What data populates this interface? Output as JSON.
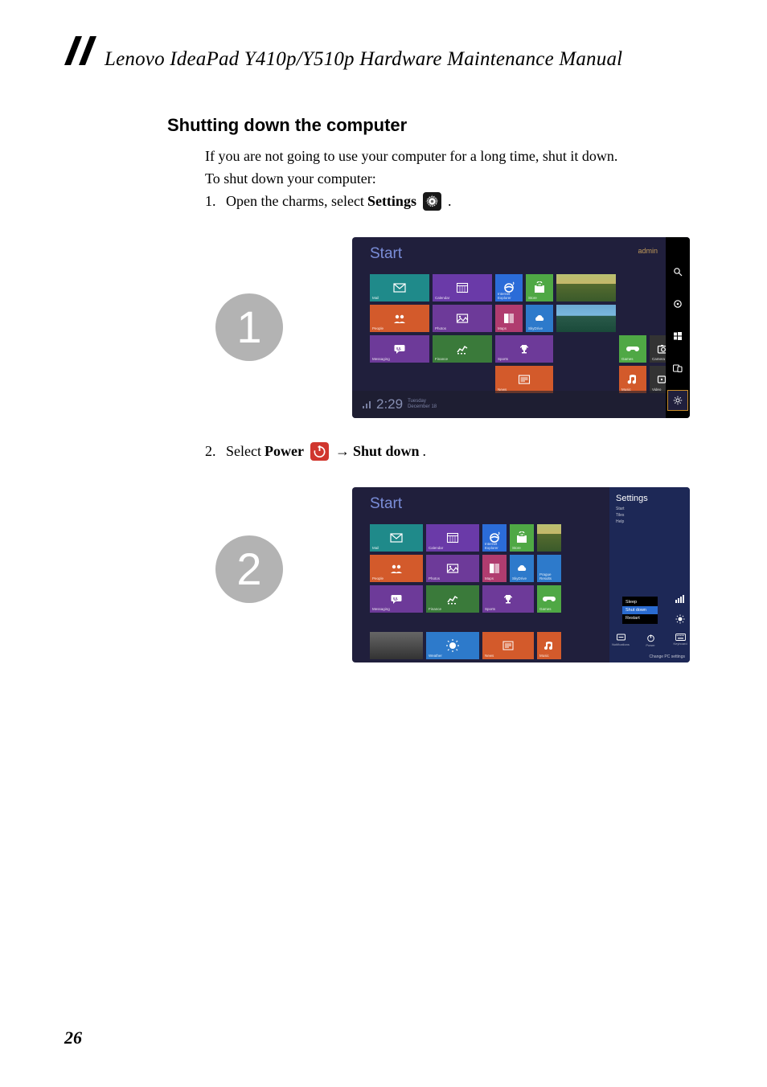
{
  "header": {
    "doc_title": "Lenovo IdeaPad Y410p/Y510p Hardware Maintenance Manual"
  },
  "section": {
    "heading": "Shutting down the computer",
    "intro1": "If you are not going to use your computer for a long time, shut it down.",
    "intro2": "To shut down your computer:"
  },
  "steps": {
    "s1_num": "1.",
    "s1_pre": "Open the charms, select ",
    "s1_bold": "Settings",
    "s1_post": " .",
    "s2_num": "2.",
    "s2_pre": "Select ",
    "s2_bold1": "Power",
    "s2_arrow": " →",
    "s2_bold2": " Shut down",
    "s2_post": "."
  },
  "figures": {
    "circle1": "1",
    "circle2": "2",
    "start_label": "Start",
    "user_label": "admin",
    "charm_labels": {
      "search": "Search",
      "share": "Share",
      "start": "Start",
      "devices": "Devices",
      "settings": "Settings"
    },
    "tiles": [
      {
        "cap": "Mail",
        "cls": "t-teal",
        "icon": "mail",
        "col": "1",
        "row": "1"
      },
      {
        "cap": "Calendar",
        "cls": "t-purple",
        "icon": "calendar",
        "col": "2",
        "row": "1"
      },
      {
        "cap": "Internet Explorer",
        "cls": "t-blue",
        "icon": "ie",
        "col": "3",
        "row": "1"
      },
      {
        "cap": "Store",
        "cls": "t-green",
        "icon": "store",
        "col": "4",
        "row": "1"
      },
      {
        "cap": "",
        "cls": "t-img1",
        "icon": "",
        "col": "5",
        "row": "1"
      },
      {
        "cap": "People",
        "cls": "t-orange",
        "icon": "people",
        "col": "1",
        "row": "2"
      },
      {
        "cap": "Photos",
        "cls": "t-violet",
        "icon": "photos",
        "col": "2",
        "row": "2"
      },
      {
        "cap": "Maps",
        "cls": "t-pink",
        "icon": "maps",
        "col": "3",
        "row": "2"
      },
      {
        "cap": "SkyDrive",
        "cls": "t-skyblue",
        "icon": "cloud",
        "col": "4",
        "row": "2"
      },
      {
        "cap": "",
        "cls": "t-img2",
        "icon": "",
        "col": "5",
        "row": "2"
      },
      {
        "cap": "Messaging",
        "cls": "t-violet",
        "icon": "msg",
        "col": "1",
        "row": "3"
      },
      {
        "cap": "Finance",
        "cls": "t-dkgreen",
        "icon": "finance",
        "col": "2",
        "row": "3"
      },
      {
        "cap": "Sports",
        "cls": "t-violet",
        "icon": "trophy",
        "col": "3 / span 2",
        "row": "3"
      },
      {
        "cap": "Games",
        "cls": "t-green",
        "icon": "game",
        "col": "6",
        "row": "3"
      },
      {
        "cap": "Camera",
        "cls": "t-gray",
        "icon": "camera",
        "col": "7",
        "row": "3"
      },
      {
        "cap": "News",
        "cls": "t-orange",
        "icon": "news",
        "col": "3 / span 2",
        "row": "4"
      },
      {
        "cap": "Music",
        "cls": "t-orange",
        "icon": "music",
        "col": "6",
        "row": "4"
      },
      {
        "cap": "Video",
        "cls": "t-gray",
        "icon": "video",
        "col": "7",
        "row": "4"
      }
    ],
    "time": "2:29",
    "day": "Tuesday",
    "date": "December 18",
    "settings_pane": {
      "title": "Settings",
      "items": [
        "Start",
        "Tiles",
        "Help"
      ],
      "power_menu": [
        "Sleep",
        "Shut down",
        "Restart"
      ],
      "bottom_icons": [
        "Notifications",
        "Power",
        "Keyboard"
      ],
      "brightness_label": "Brightness",
      "change": "Change PC settings"
    }
  },
  "page_number": "26"
}
